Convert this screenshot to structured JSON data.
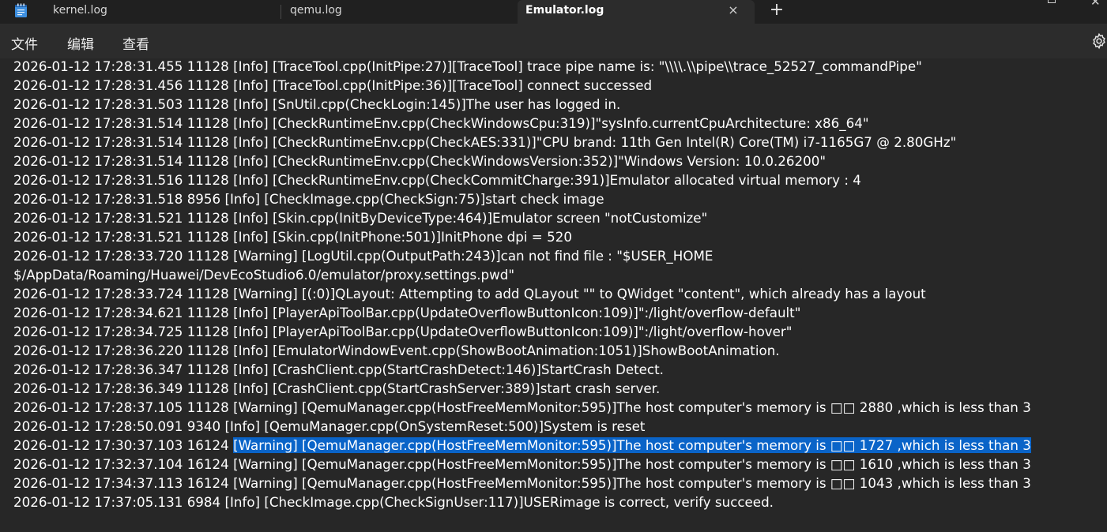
{
  "tabs": [
    {
      "label": "kernel.log",
      "active": false
    },
    {
      "label": "qemu.log",
      "active": false
    },
    {
      "label": "Emulator.log",
      "active": true
    }
  ],
  "tab_close_icon": "×",
  "new_tab_icon": "+",
  "menu": {
    "items": [
      "文件",
      "编辑",
      "查看"
    ],
    "settings_icon": "gear-icon"
  },
  "colors": {
    "background": "#272727",
    "tabbar": "#202020",
    "menubar": "#2c2c2c",
    "selection": "#0a64c8",
    "text": "#ffffff"
  },
  "log": [
    {
      "text": "2026-01-12 17:28:31.455 11128 [Info] [TraceTool.cpp(InitPipe:27)][TraceTool] trace pipe name is: \"\\\\\\\\.\\\\pipe\\\\trace_52527_commandPipe\""
    },
    {
      "text": "2026-01-12 17:28:31.456 11128 [Info] [TraceTool.cpp(InitPipe:36)][TraceTool] connect successed"
    },
    {
      "text": "2026-01-12 17:28:31.503 11128 [Info] [SnUtil.cpp(CheckLogin:145)]The user has logged in."
    },
    {
      "text": "2026-01-12 17:28:31.514 11128 [Info] [CheckRuntimeEnv.cpp(CheckWindowsCpu:319)]\"sysInfo.currentCpuArchitecture: x86_64\""
    },
    {
      "text": "2026-01-12 17:28:31.514 11128 [Info] [CheckRuntimeEnv.cpp(CheckAES:331)]\"CPU brand: 11th Gen Intel(R) Core(TM) i7-1165G7 @ 2.80GHz\""
    },
    {
      "text": "2026-01-12 17:28:31.514 11128 [Info] [CheckRuntimeEnv.cpp(CheckWindowsVersion:352)]\"Windows Version: 10.0.26200\""
    },
    {
      "text": "2026-01-12 17:28:31.516 11128 [Info] [CheckRuntimeEnv.cpp(CheckCommitCharge:391)]Emulator allocated virtual memory :  4"
    },
    {
      "text": "2026-01-12 17:28:31.518 8956 [Info] [CheckImage.cpp(CheckSign:75)]start check image"
    },
    {
      "text": "2026-01-12 17:28:31.521 11128 [Info] [Skin.cpp(InitByDeviceType:464)]Emulator screen  \"notCustomize\""
    },
    {
      "text": "2026-01-12 17:28:31.521 11128 [Info] [Skin.cpp(InitPhone:501)]InitPhone dpi =  520"
    },
    {
      "text": "2026-01-12 17:28:33.720 11128 [Warning] [LogUtil.cpp(OutputPath:243)]can not find file :  \"$USER_HOME"
    },
    {
      "text": "$/AppData/Roaming/Huawei/DevEcoStudio6.0/emulator/proxy.settings.pwd\""
    },
    {
      "text": "2026-01-12 17:28:33.724 11128 [Warning] [(:0)]QLayout: Attempting to add QLayout \"\" to QWidget \"content\", which already has a layout"
    },
    {
      "text": "2026-01-12 17:28:34.621 11128 [Info] [PlayerApiToolBar.cpp(UpdateOverflowButtonIcon:109)]\":/light/overflow-default\""
    },
    {
      "text": "2026-01-12 17:28:34.725 11128 [Info] [PlayerApiToolBar.cpp(UpdateOverflowButtonIcon:109)]\":/light/overflow-hover\""
    },
    {
      "text": "2026-01-12 17:28:36.220 11128 [Info] [EmulatorWindowEvent.cpp(ShowBootAnimation:1051)]ShowBootAnimation."
    },
    {
      "text": "2026-01-12 17:28:36.347 11128 [Info] [CrashClient.cpp(StartCrashDetect:146)]StartCrash Detect."
    },
    {
      "text": "2026-01-12 17:28:36.349 11128 [Info] [CrashClient.cpp(StartCrashServer:389)]start crash server."
    },
    {
      "text": "2026-01-12 17:28:37.105 11128 [Warning] [QemuManager.cpp(HostFreeMemMonitor:595)]The host computer's memory is □□ 2880  ,which is less than  3"
    },
    {
      "text": "2026-01-12 17:28:50.091 9340 [Info] [QemuManager.cpp(OnSystemReset:500)]System is reset"
    },
    {
      "text": "2026-01-12 17:30:37.103 16124 ",
      "selected": "[Warning] [QemuManager.cpp(HostFreeMemMonitor:595)]The host computer's memory is □□ 1727  ,which is less than  3"
    },
    {
      "text": "2026-01-12 17:32:37.104 16124 [Warning] [QemuManager.cpp(HostFreeMemMonitor:595)]The host computer's memory is □□ 1610  ,which is less than  3"
    },
    {
      "text": "2026-01-12 17:34:37.113 16124 [Warning] [QemuManager.cpp(HostFreeMemMonitor:595)]The host computer's memory is □□ 1043  ,which is less than  3"
    },
    {
      "text": "2026-01-12 17:37:05.131 6984 [Info] [CheckImage.cpp(CheckSignUser:117)]USERimage is correct, verify succeed."
    }
  ]
}
